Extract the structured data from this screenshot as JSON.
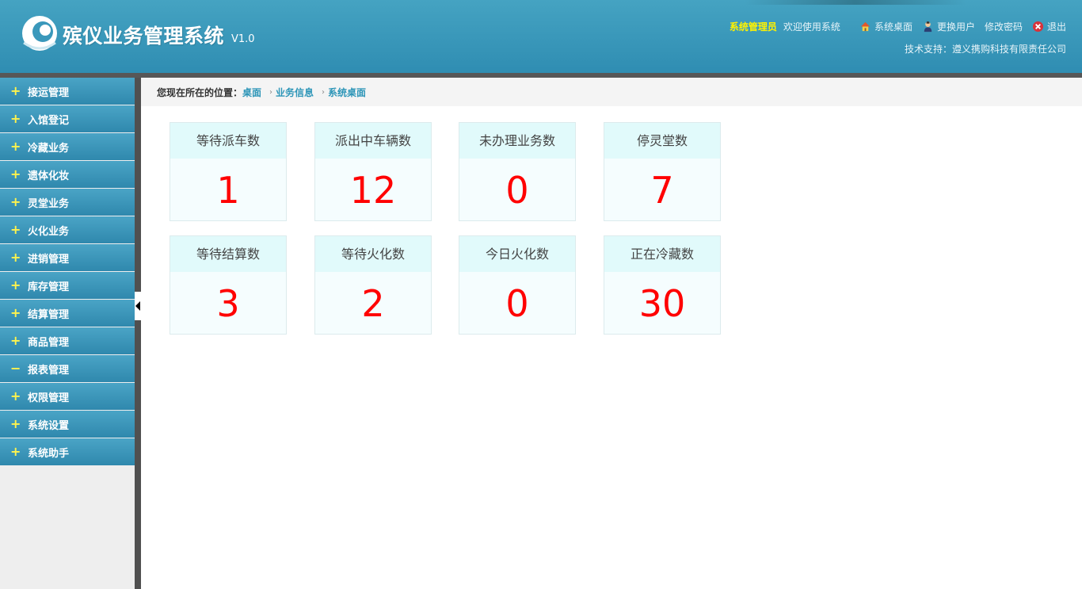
{
  "header": {
    "title": "殡仪业务管理系统",
    "version": "V1.0",
    "admin_label": "系统管理员",
    "welcome": "欢迎使用系统",
    "links": {
      "desktop": "系统桌面",
      "switch_user": "更换用户",
      "change_password": "修改密码",
      "logout": "退出"
    },
    "support": "技术支持：遵义携购科技有限责任公司"
  },
  "sidebar": {
    "items": [
      {
        "label": "接运管理",
        "sign": "+"
      },
      {
        "label": "入馆登记",
        "sign": "+"
      },
      {
        "label": "冷藏业务",
        "sign": "+"
      },
      {
        "label": "遗体化妆",
        "sign": "+"
      },
      {
        "label": "灵堂业务",
        "sign": "+"
      },
      {
        "label": "火化业务",
        "sign": "+"
      },
      {
        "label": "进销管理",
        "sign": "+"
      },
      {
        "label": "库存管理",
        "sign": "+"
      },
      {
        "label": "结算管理",
        "sign": "+"
      },
      {
        "label": "商品管理",
        "sign": "+"
      },
      {
        "label": "报表管理",
        "sign": "−"
      },
      {
        "label": "权限管理",
        "sign": "+"
      },
      {
        "label": "系统设置",
        "sign": "+"
      },
      {
        "label": "系统助手",
        "sign": "+"
      }
    ]
  },
  "breadcrumb": {
    "prefix": "您现在所在的位置：",
    "crumbs": [
      "桌面",
      "业务信息",
      "系统桌面"
    ],
    "separator": "›"
  },
  "stats": [
    {
      "title": "等待派车数",
      "value": "1"
    },
    {
      "title": "派出中车辆数",
      "value": "12"
    },
    {
      "title": "未办理业务数",
      "value": "0"
    },
    {
      "title": "停灵堂数",
      "value": "7"
    },
    {
      "title": "等待结算数",
      "value": "3"
    },
    {
      "title": "等待火化数",
      "value": "2"
    },
    {
      "title": "今日火化数",
      "value": "0"
    },
    {
      "title": "正在冷藏数",
      "value": "30"
    }
  ],
  "colors": {
    "header": "#3a98bb",
    "accent_value": "#ff0000",
    "admin": "#fff200",
    "crumb": "#2e96b8"
  }
}
